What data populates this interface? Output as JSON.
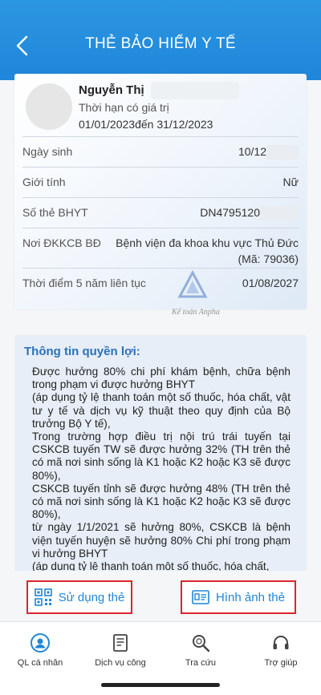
{
  "header": {
    "title": "THẺ BẢO HIỂM Y TẾ",
    "back_icon": "chevron-left-icon"
  },
  "card": {
    "name": "Nguyễn Thị",
    "validity_label": "Thời hạn có giá trị",
    "validity_range": "01/01/2023đến  31/12/2023",
    "rows": [
      {
        "label": "Ngày sinh",
        "value": "10/12"
      },
      {
        "label": "Giới tính",
        "value": "Nữ"
      },
      {
        "label": "Số thẻ BHYT",
        "value": "DN4795120"
      },
      {
        "label": "Nơi ĐKKCB BĐ",
        "value": "Bệnh viện đa khoa khu vực Thủ Đức",
        "value2": "(Mã: 79036)"
      },
      {
        "label": "Thời điểm 5 năm liên tục",
        "value": "01/08/2027"
      }
    ]
  },
  "watermark": {
    "text": "Kế toán Anpha"
  },
  "benefits": {
    "title": "Thông tin quyền lợi:",
    "text": "Được hưởng 80% chi phí khám bệnh, chữa bệnh trong phạm vi được hưởng BHYT\n(áp dụng tỷ lệ thanh toán một số thuốc, hóa chất, vật tư y tế và dịch vụ kỹ thuật theo quy định của Bộ trưởng Bộ Y tế),\nTrong trường hợp điều trị nội trú trái tuyến tại CSKCB tuyến TW sẽ được hưởng 32% (TH trên thẻ có mã nơi sinh sống là K1 hoặc K2 hoặc K3 sẽ được 80%),\nCSKCB tuyến tỉnh sẽ được hưởng 48% (TH trên thẻ có mã nơi sinh sống là K1 hoặc K2 hoặc K3 sẽ được 80%),\ntừ ngày 1/1/2021 sẽ hưởng 80%, CSKCB là bệnh viện tuyến huyện sẽ hưởng 80% Chi phí trong phạm vi hưởng BHYT\n(áp dụng tỷ lệ thanh toán một số thuốc, hóa chất,"
  },
  "actions": {
    "use_card": {
      "label": "Sử dụng thẻ",
      "icon": "qr-code-icon"
    },
    "card_image": {
      "label": "Hình ảnh  thẻ",
      "icon": "id-card-icon"
    }
  },
  "nav": [
    {
      "label": "QL cá nhân",
      "icon": "personal-icon"
    },
    {
      "label": "Dịch vụ công",
      "icon": "document-icon"
    },
    {
      "label": "Tra cứu",
      "icon": "search-icon"
    },
    {
      "label": "Trợ giúp",
      "icon": "headset-icon"
    }
  ],
  "colors": {
    "primary": "#1f86d9",
    "highlight_border": "#d9262c",
    "title_blue": "#2a71b8"
  }
}
